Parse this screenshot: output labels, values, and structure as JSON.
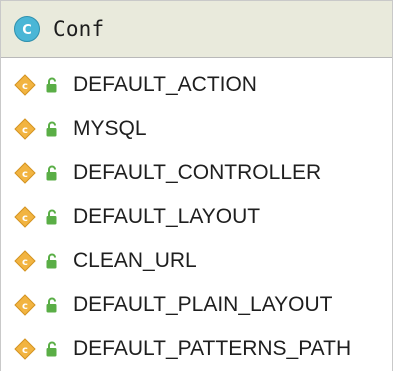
{
  "header": {
    "icon": "class-icon",
    "icon_letter": "C",
    "title": "Conf"
  },
  "items": [
    {
      "label": "DEFAULT_ACTION",
      "icon": "constant-field-icon",
      "visibility": "public-lock-icon"
    },
    {
      "label": "MYSQL",
      "icon": "constant-field-icon",
      "visibility": "public-lock-icon"
    },
    {
      "label": "DEFAULT_CONTROLLER",
      "icon": "constant-field-icon",
      "visibility": "public-lock-icon"
    },
    {
      "label": "DEFAULT_LAYOUT",
      "icon": "constant-field-icon",
      "visibility": "public-lock-icon"
    },
    {
      "label": "CLEAN_URL",
      "icon": "constant-field-icon",
      "visibility": "public-lock-icon"
    },
    {
      "label": "DEFAULT_PLAIN_LAYOUT",
      "icon": "constant-field-icon",
      "visibility": "public-lock-icon"
    },
    {
      "label": "DEFAULT_PATTERNS_PATH",
      "icon": "constant-field-icon",
      "visibility": "public-lock-icon"
    }
  ],
  "colors": {
    "header_bg": "#e9eadc",
    "class_icon_fill": "#4ab6d6",
    "constant_icon_fill": "#f2b441",
    "lock_green": "#5aae46"
  }
}
